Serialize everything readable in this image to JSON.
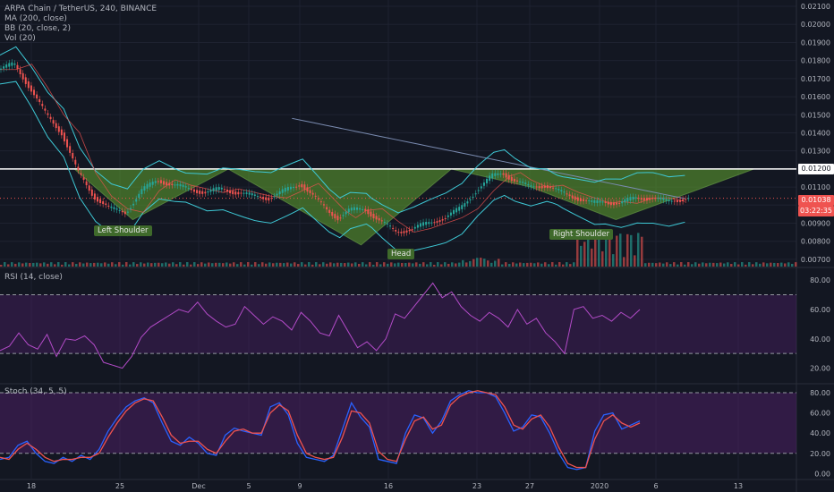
{
  "legend": {
    "symbol": "ARPA Chain / TetherUS, 240, BINANCE",
    "ma": "MA (200, close)",
    "bb": "BB (20, close, 2)",
    "vol": "Vol (20)"
  },
  "panes": {
    "rsi": "RSI (14, close)",
    "stoch": "Stoch (34, 5, 5)"
  },
  "annotations": {
    "left_shoulder": "Left Shoulder",
    "head": "Head",
    "right_shoulder": "Right Shoulder"
  },
  "price_tags": {
    "neckline": "0.01200",
    "last_price": "0.01038",
    "countdown": "03:22:35"
  },
  "colors": {
    "background": "#131722",
    "candle_up": "#26a69a",
    "candle_down": "#ef5350",
    "bollinger": "#3ec9d6",
    "ma": "#7a8bb0",
    "pattern_fill": "#5b9a2e",
    "rsi_line": "#b34bc8",
    "stoch_k": "#2962ff",
    "stoch_d": "#ef5350",
    "band_fill": "#4a1f63"
  },
  "chart_data": [
    {
      "type": "line",
      "pane": "price",
      "x_ticks": [
        "18",
        "25",
        "Dec",
        "5",
        "9",
        "16",
        "23",
        "27",
        "2020",
        "6",
        "13"
      ],
      "y_ticks": [
        "0.02100",
        "0.02000",
        "0.01900",
        "0.01800",
        "0.01700",
        "0.01600",
        "0.01500",
        "0.01400",
        "0.01300",
        "0.01200",
        "0.01100",
        "0.01000",
        "0.00900",
        "0.00800",
        "0.00700"
      ],
      "ylim": [
        0.0066,
        0.0212
      ],
      "neckline": 0.012,
      "last_price": 0.01038,
      "pattern_points": [
        [
          0.14,
          0.012
        ],
        [
          0.25,
          0.0092
        ],
        [
          0.43,
          0.012
        ],
        [
          0.68,
          0.0078
        ],
        [
          0.85,
          0.012
        ],
        [
          1.0,
          0.011
        ],
        [
          1.16,
          0.0092
        ],
        [
          1.42,
          0.012
        ]
      ],
      "price_path": [
        [
          0.0,
          0.0175
        ],
        [
          0.03,
          0.0178
        ],
        [
          0.06,
          0.0165
        ],
        [
          0.09,
          0.015
        ],
        [
          0.12,
          0.014
        ],
        [
          0.15,
          0.0118
        ],
        [
          0.18,
          0.0105
        ],
        [
          0.21,
          0.0098
        ],
        [
          0.24,
          0.0096
        ],
        [
          0.27,
          0.0108
        ],
        [
          0.3,
          0.0114
        ],
        [
          0.33,
          0.0111
        ],
        [
          0.36,
          0.0109
        ],
        [
          0.39,
          0.0107
        ],
        [
          0.42,
          0.0109
        ],
        [
          0.45,
          0.0107
        ],
        [
          0.48,
          0.0105
        ],
        [
          0.51,
          0.0104
        ],
        [
          0.54,
          0.0108
        ],
        [
          0.57,
          0.0112
        ],
        [
          0.6,
          0.0103
        ],
        [
          0.62,
          0.0097
        ],
        [
          0.64,
          0.0093
        ],
        [
          0.66,
          0.0097
        ],
        [
          0.69,
          0.0098
        ],
        [
          0.72,
          0.0091
        ],
        [
          0.75,
          0.0085
        ],
        [
          0.78,
          0.0087
        ],
        [
          0.81,
          0.009
        ],
        [
          0.84,
          0.0093
        ],
        [
          0.87,
          0.0098
        ],
        [
          0.9,
          0.0108
        ],
        [
          0.93,
          0.0116
        ],
        [
          0.95,
          0.0118
        ],
        [
          0.97,
          0.0114
        ],
        [
          1.0,
          0.011
        ],
        [
          1.03,
          0.0111
        ],
        [
          1.06,
          0.0107
        ],
        [
          1.09,
          0.0104
        ],
        [
          1.12,
          0.0101
        ],
        [
          1.14,
          0.0102
        ],
        [
          1.17,
          0.0101
        ],
        [
          1.2,
          0.0104
        ],
        [
          1.23,
          0.0104
        ],
        [
          1.26,
          0.0102
        ],
        [
          1.3,
          0.0104
        ]
      ]
    },
    {
      "type": "line",
      "pane": "rsi",
      "y_ticks": [
        "80.00",
        "60.00",
        "40.00",
        "20.00"
      ],
      "ylim": [
        10,
        88
      ],
      "bands": [
        30,
        70
      ],
      "values": [
        32,
        35,
        44,
        36,
        33,
        43,
        28,
        40,
        39,
        42,
        36,
        24,
        22,
        20,
        28,
        41,
        48,
        52,
        56,
        60,
        58,
        65,
        57,
        52,
        48,
        50,
        62,
        56,
        50,
        55,
        52,
        46,
        58,
        52,
        44,
        42,
        56,
        45,
        34,
        38,
        32,
        40,
        57,
        54,
        62,
        70,
        78,
        68,
        72,
        62,
        56,
        52,
        58,
        54,
        48,
        60,
        50,
        54,
        44,
        38,
        30,
        60,
        62,
        54,
        56,
        52,
        58,
        54,
        60
      ]
    },
    {
      "type": "line",
      "pane": "stoch",
      "y_ticks": [
        "80.00",
        "60.00",
        "40.00",
        "20.00",
        "0.00"
      ],
      "ylim": [
        -5,
        88
      ],
      "bands": [
        20,
        80
      ],
      "series": [
        {
          "values": [
            14,
            16,
            28,
            32,
            20,
            12,
            10,
            16,
            12,
            18,
            14,
            24,
            42,
            55,
            66,
            72,
            75,
            70,
            50,
            32,
            28,
            36,
            30,
            20,
            18,
            38,
            45,
            42,
            40,
            38,
            66,
            70,
            58,
            30,
            16,
            14,
            12,
            18,
            44,
            70,
            56,
            46,
            14,
            12,
            10,
            40,
            58,
            55,
            40,
            52,
            72,
            78,
            82,
            80,
            80,
            76,
            60,
            42,
            46,
            58,
            56,
            40,
            20,
            6,
            4,
            6,
            42,
            58,
            60,
            44,
            48,
            52
          ]
        },
        {
          "values": [
            16,
            14,
            24,
            30,
            24,
            16,
            12,
            14,
            14,
            16,
            16,
            20,
            36,
            50,
            62,
            70,
            74,
            72,
            56,
            38,
            30,
            32,
            32,
            24,
            20,
            32,
            42,
            44,
            40,
            40,
            60,
            68,
            62,
            38,
            20,
            16,
            14,
            16,
            36,
            62,
            60,
            50,
            22,
            14,
            12,
            34,
            52,
            56,
            44,
            48,
            68,
            76,
            80,
            82,
            80,
            78,
            66,
            48,
            44,
            54,
            58,
            46,
            26,
            10,
            6,
            6,
            34,
            52,
            58,
            50,
            46,
            50
          ]
        }
      ]
    }
  ]
}
